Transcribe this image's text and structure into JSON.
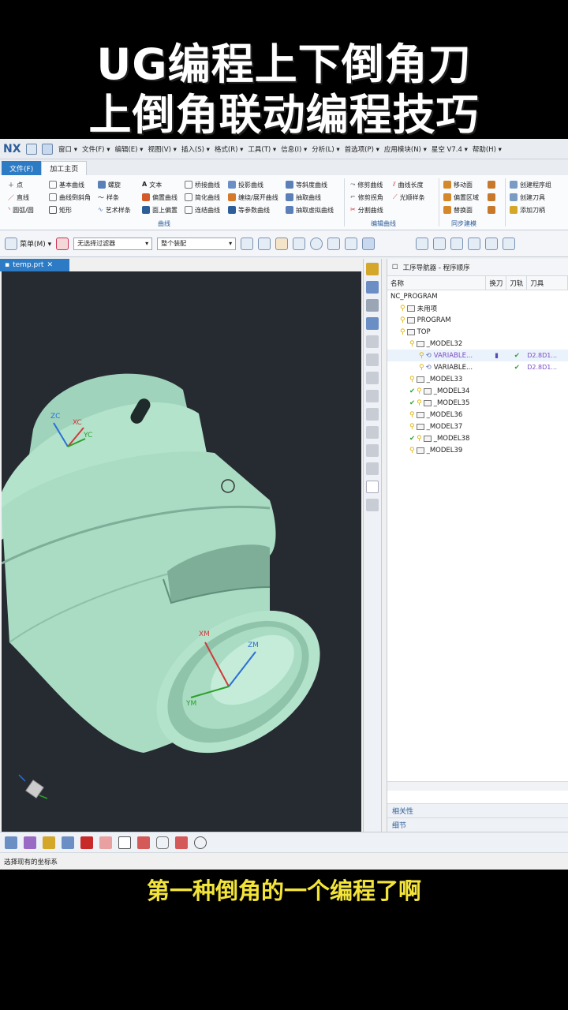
{
  "video": {
    "title_line1": "UG编程上下倒角刀",
    "title_line2": "上倒角联动编程技巧",
    "subtitle": "第一种倒角的一个编程了啊"
  },
  "app": {
    "logo": "NX",
    "menu": [
      "窗口 ▾",
      "文件(F) ▾",
      "编辑(E) ▾",
      "视图(V) ▾",
      "插入(S) ▾",
      "格式(R) ▾",
      "工具(T) ▾",
      "信息(I) ▾",
      "分析(L) ▾",
      "首选项(P) ▾",
      "应用模块(N) ▾",
      "星空 V7.4 ▾",
      "帮助(H) ▾"
    ],
    "tabs": {
      "file": "文件(F)",
      "home": "加工主页"
    }
  },
  "ribbon": {
    "col1": [
      "点",
      "直线",
      "圆弧/圆"
    ],
    "col2": [
      "基本曲线",
      "曲线倒斜角",
      "矩形"
    ],
    "col3": [
      "螺旋",
      "样条",
      "艺术样条"
    ],
    "col4": [
      "文本",
      "偏置曲线",
      "面上偏置"
    ],
    "col5": [
      "桥接曲线",
      "简化曲线",
      "连结曲线"
    ],
    "col6": [
      "投影曲线",
      "缠绕/展开曲线",
      "等参数曲线"
    ],
    "col7": [
      "等斜度曲线",
      "抽取曲线",
      "抽取虚拟曲线"
    ],
    "col8": [
      "修剪曲线",
      "修剪拐角",
      "分割曲线"
    ],
    "col9": [
      "曲线长度",
      "光顺样条"
    ],
    "col10": [
      "移动面",
      "偏置区域",
      "替换面"
    ],
    "col11": [
      "创建程序组",
      "创建刀具",
      "添加刀柄"
    ],
    "group_curve": "曲线",
    "group_edit": "编辑曲线",
    "group_sync": "同步建模"
  },
  "toolbar": {
    "menu_label": "菜单(M) ▾",
    "filter": "无选择过滤器",
    "assembly": "整个装配"
  },
  "document": {
    "tab": "temp.prt"
  },
  "viewport": {
    "wcs": {
      "zc": "ZC",
      "xc": "XC",
      "yc": "YC"
    },
    "mcs": {
      "xm": "XM",
      "ym": "YM",
      "zm": "ZM"
    }
  },
  "navigator": {
    "title": "工序导航器 - 程序顺序",
    "columns": [
      "名称",
      "换刀",
      "刀轨",
      "刀具"
    ],
    "rows": [
      {
        "indent": 0,
        "name": "NC_PROGRAM",
        "type": "root",
        "c1": "",
        "c2": "",
        "c3": ""
      },
      {
        "indent": 1,
        "name": "未用项",
        "type": "folder",
        "c1": "",
        "c2": "",
        "c3": ""
      },
      {
        "indent": 1,
        "name": "PROGRAM",
        "type": "folder",
        "c1": "",
        "c2": "",
        "c3": ""
      },
      {
        "indent": 1,
        "name": "TOP",
        "type": "folder",
        "c1": "",
        "c2": "",
        "c3": ""
      },
      {
        "indent": 2,
        "name": "_MODEL32",
        "type": "folder",
        "c1": "",
        "c2": "",
        "c3": ""
      },
      {
        "indent": 3,
        "name": "VARIABLE...",
        "type": "op-sel",
        "c1": "▮",
        "c2": "✔",
        "c3": "D2.8D1..."
      },
      {
        "indent": 3,
        "name": "VARIABLE...",
        "type": "op",
        "c1": "",
        "c2": "✔",
        "c3": "D2.8D1..."
      },
      {
        "indent": 2,
        "name": "_MODEL33",
        "type": "folder",
        "c1": "",
        "c2": "",
        "c3": ""
      },
      {
        "indent": 2,
        "name": "_MODEL34",
        "type": "folder-check",
        "c1": "",
        "c2": "",
        "c3": ""
      },
      {
        "indent": 2,
        "name": "_MODEL35",
        "type": "folder-check",
        "c1": "",
        "c2": "",
        "c3": ""
      },
      {
        "indent": 2,
        "name": "_MODEL36",
        "type": "folder",
        "c1": "",
        "c2": "",
        "c3": ""
      },
      {
        "indent": 2,
        "name": "_MODEL37",
        "type": "folder",
        "c1": "",
        "c2": "",
        "c3": ""
      },
      {
        "indent": 2,
        "name": "_MODEL38",
        "type": "folder-check",
        "c1": "",
        "c2": "",
        "c3": ""
      },
      {
        "indent": 2,
        "name": "_MODEL39",
        "type": "folder",
        "c1": "",
        "c2": "",
        "c3": ""
      }
    ],
    "panel_dependencies": "相关性",
    "panel_details": "细节"
  },
  "status_text": "选择现有的坐标系",
  "colors": {
    "part": "#a9dcc3",
    "viewport_bg": "#262a31",
    "accent": "#2d7bc4"
  }
}
